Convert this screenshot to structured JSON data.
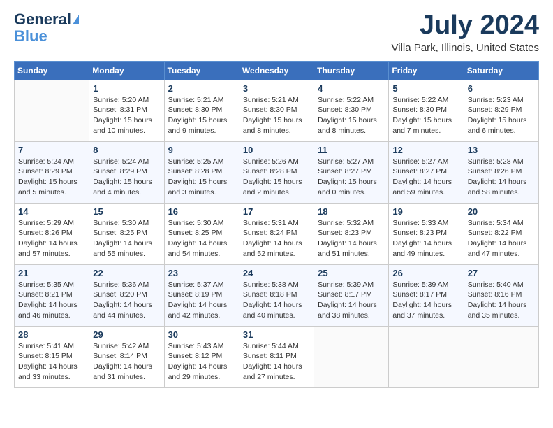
{
  "header": {
    "logo_line1": "General",
    "logo_line2": "Blue",
    "month": "July 2024",
    "location": "Villa Park, Illinois, United States"
  },
  "weekdays": [
    "Sunday",
    "Monday",
    "Tuesday",
    "Wednesday",
    "Thursday",
    "Friday",
    "Saturday"
  ],
  "weeks": [
    [
      {
        "day": "",
        "info": ""
      },
      {
        "day": "1",
        "info": "Sunrise: 5:20 AM\nSunset: 8:31 PM\nDaylight: 15 hours\nand 10 minutes."
      },
      {
        "day": "2",
        "info": "Sunrise: 5:21 AM\nSunset: 8:30 PM\nDaylight: 15 hours\nand 9 minutes."
      },
      {
        "day": "3",
        "info": "Sunrise: 5:21 AM\nSunset: 8:30 PM\nDaylight: 15 hours\nand 8 minutes."
      },
      {
        "day": "4",
        "info": "Sunrise: 5:22 AM\nSunset: 8:30 PM\nDaylight: 15 hours\nand 8 minutes."
      },
      {
        "day": "5",
        "info": "Sunrise: 5:22 AM\nSunset: 8:30 PM\nDaylight: 15 hours\nand 7 minutes."
      },
      {
        "day": "6",
        "info": "Sunrise: 5:23 AM\nSunset: 8:29 PM\nDaylight: 15 hours\nand 6 minutes."
      }
    ],
    [
      {
        "day": "7",
        "info": "Sunrise: 5:24 AM\nSunset: 8:29 PM\nDaylight: 15 hours\nand 5 minutes."
      },
      {
        "day": "8",
        "info": "Sunrise: 5:24 AM\nSunset: 8:29 PM\nDaylight: 15 hours\nand 4 minutes."
      },
      {
        "day": "9",
        "info": "Sunrise: 5:25 AM\nSunset: 8:28 PM\nDaylight: 15 hours\nand 3 minutes."
      },
      {
        "day": "10",
        "info": "Sunrise: 5:26 AM\nSunset: 8:28 PM\nDaylight: 15 hours\nand 2 minutes."
      },
      {
        "day": "11",
        "info": "Sunrise: 5:27 AM\nSunset: 8:27 PM\nDaylight: 15 hours\nand 0 minutes."
      },
      {
        "day": "12",
        "info": "Sunrise: 5:27 AM\nSunset: 8:27 PM\nDaylight: 14 hours\nand 59 minutes."
      },
      {
        "day": "13",
        "info": "Sunrise: 5:28 AM\nSunset: 8:26 PM\nDaylight: 14 hours\nand 58 minutes."
      }
    ],
    [
      {
        "day": "14",
        "info": "Sunrise: 5:29 AM\nSunset: 8:26 PM\nDaylight: 14 hours\nand 57 minutes."
      },
      {
        "day": "15",
        "info": "Sunrise: 5:30 AM\nSunset: 8:25 PM\nDaylight: 14 hours\nand 55 minutes."
      },
      {
        "day": "16",
        "info": "Sunrise: 5:30 AM\nSunset: 8:25 PM\nDaylight: 14 hours\nand 54 minutes."
      },
      {
        "day": "17",
        "info": "Sunrise: 5:31 AM\nSunset: 8:24 PM\nDaylight: 14 hours\nand 52 minutes."
      },
      {
        "day": "18",
        "info": "Sunrise: 5:32 AM\nSunset: 8:23 PM\nDaylight: 14 hours\nand 51 minutes."
      },
      {
        "day": "19",
        "info": "Sunrise: 5:33 AM\nSunset: 8:23 PM\nDaylight: 14 hours\nand 49 minutes."
      },
      {
        "day": "20",
        "info": "Sunrise: 5:34 AM\nSunset: 8:22 PM\nDaylight: 14 hours\nand 47 minutes."
      }
    ],
    [
      {
        "day": "21",
        "info": "Sunrise: 5:35 AM\nSunset: 8:21 PM\nDaylight: 14 hours\nand 46 minutes."
      },
      {
        "day": "22",
        "info": "Sunrise: 5:36 AM\nSunset: 8:20 PM\nDaylight: 14 hours\nand 44 minutes."
      },
      {
        "day": "23",
        "info": "Sunrise: 5:37 AM\nSunset: 8:19 PM\nDaylight: 14 hours\nand 42 minutes."
      },
      {
        "day": "24",
        "info": "Sunrise: 5:38 AM\nSunset: 8:18 PM\nDaylight: 14 hours\nand 40 minutes."
      },
      {
        "day": "25",
        "info": "Sunrise: 5:39 AM\nSunset: 8:17 PM\nDaylight: 14 hours\nand 38 minutes."
      },
      {
        "day": "26",
        "info": "Sunrise: 5:39 AM\nSunset: 8:17 PM\nDaylight: 14 hours\nand 37 minutes."
      },
      {
        "day": "27",
        "info": "Sunrise: 5:40 AM\nSunset: 8:16 PM\nDaylight: 14 hours\nand 35 minutes."
      }
    ],
    [
      {
        "day": "28",
        "info": "Sunrise: 5:41 AM\nSunset: 8:15 PM\nDaylight: 14 hours\nand 33 minutes."
      },
      {
        "day": "29",
        "info": "Sunrise: 5:42 AM\nSunset: 8:14 PM\nDaylight: 14 hours\nand 31 minutes."
      },
      {
        "day": "30",
        "info": "Sunrise: 5:43 AM\nSunset: 8:12 PM\nDaylight: 14 hours\nand 29 minutes."
      },
      {
        "day": "31",
        "info": "Sunrise: 5:44 AM\nSunset: 8:11 PM\nDaylight: 14 hours\nand 27 minutes."
      },
      {
        "day": "",
        "info": ""
      },
      {
        "day": "",
        "info": ""
      },
      {
        "day": "",
        "info": ""
      }
    ]
  ]
}
